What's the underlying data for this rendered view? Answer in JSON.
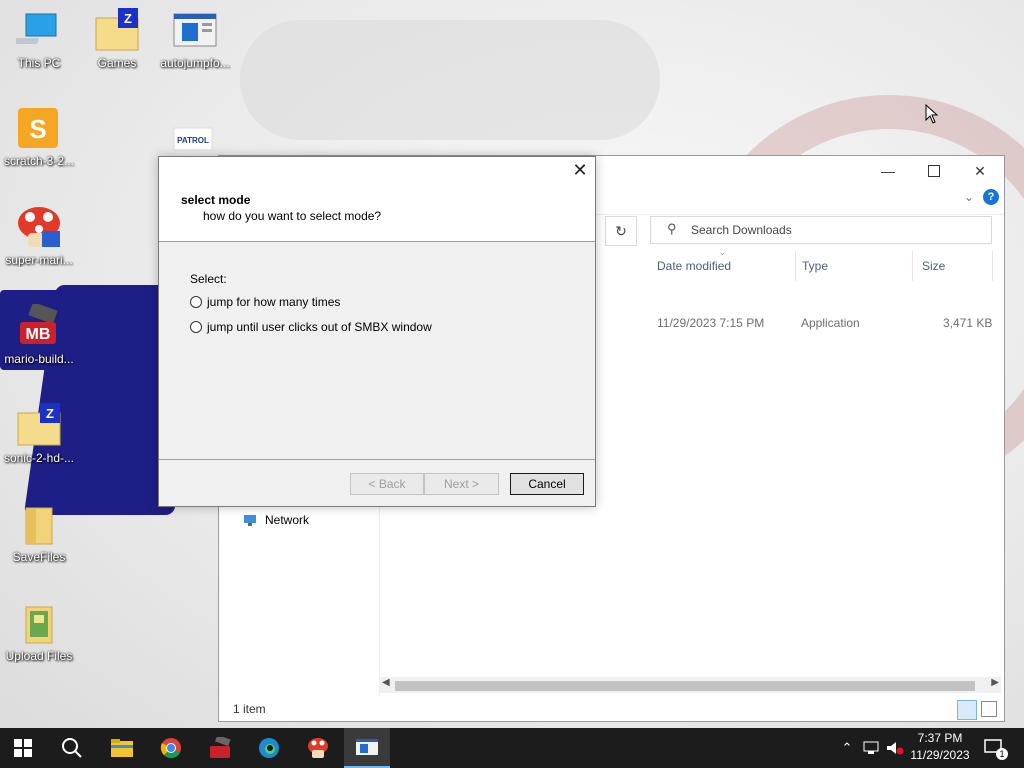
{
  "desktop": {
    "icons": [
      {
        "label": "This PC"
      },
      {
        "label": "Games"
      },
      {
        "label": "autojumpfo..."
      },
      {
        "label": "scratch-3-2..."
      },
      {
        "label": "super-mari..."
      },
      {
        "label": "mario-build..."
      },
      {
        "label": "sonic-2-hd-..."
      },
      {
        "label": "SaveFiles"
      },
      {
        "label": "Upload Files"
      }
    ],
    "partial_icon_label": "PATROL"
  },
  "explorer": {
    "search_placeholder": "Search Downloads",
    "columns": [
      "Date modified",
      "Type",
      "Size"
    ],
    "row": {
      "date": "11/29/2023 7:15 PM",
      "type": "Application",
      "size": "3,471 KB"
    },
    "nav_network": "Network",
    "status": "1 item",
    "help_icon": "?"
  },
  "dialog": {
    "heading": "select mode",
    "subheading": "how do you want to select mode?",
    "select_label": "Select:",
    "options": [
      "jump for how many times",
      "jump until user clicks out of SMBX window"
    ],
    "buttons": {
      "back": "< Back",
      "next": "Next >",
      "cancel": "Cancel"
    }
  },
  "taskbar": {
    "time": "7:37 PM",
    "date": "11/29/2023",
    "notification_count": "1"
  }
}
